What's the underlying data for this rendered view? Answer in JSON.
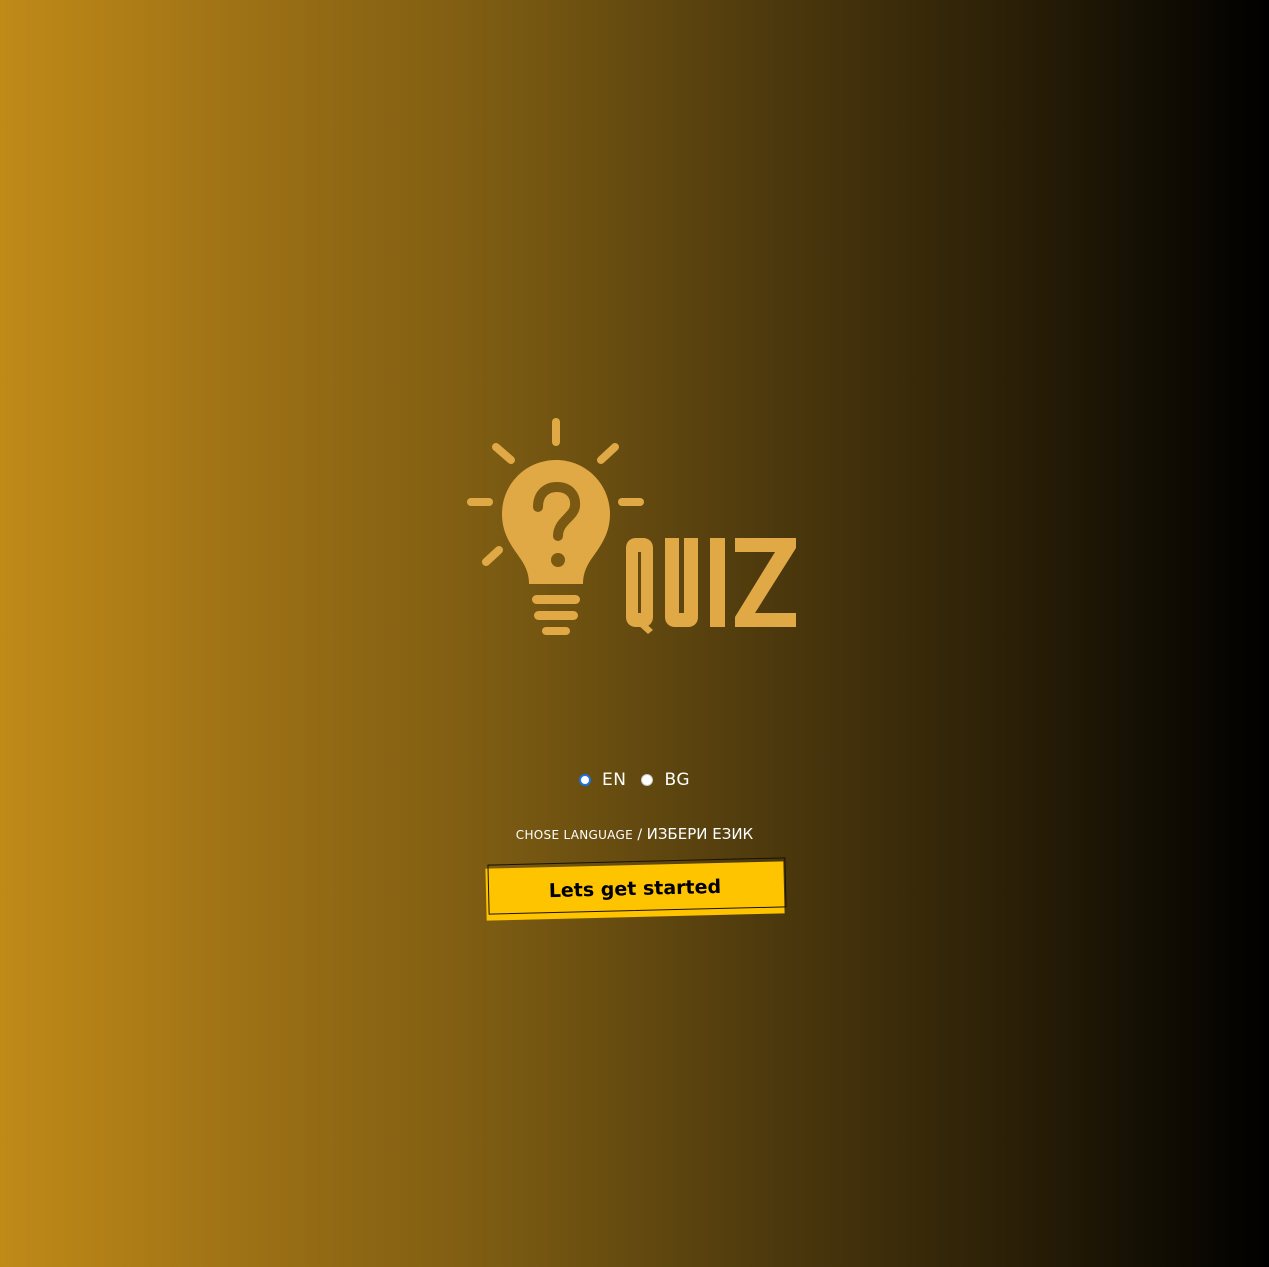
{
  "colors": {
    "logo": "#e0a945",
    "button_bg": "#ffc400",
    "gradient_start": "#c08a18",
    "gradient_end": "#000000"
  },
  "logo": {
    "icon": "lightbulb-question-icon",
    "word": "QUIZ"
  },
  "language": {
    "options": [
      {
        "code": "en",
        "label": "EN",
        "selected": true
      },
      {
        "code": "bg",
        "label": "BG",
        "selected": false
      }
    ],
    "prompt_en": "CHOSE LANGUAGE",
    "prompt_sep": " / ",
    "prompt_bg": "ИЗБЕРИ ЕЗИК"
  },
  "start_button": {
    "label": "Lets get started"
  }
}
